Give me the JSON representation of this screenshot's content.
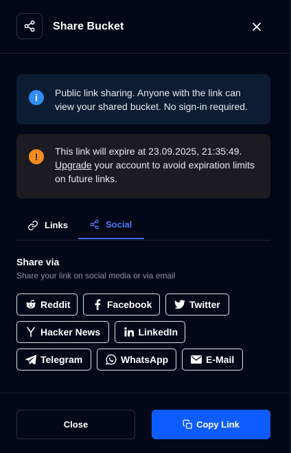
{
  "dialog": {
    "title": "Share Bucket",
    "icon": "share-icon",
    "close_icon": "close-icon"
  },
  "alerts": {
    "info": {
      "icon": "info-icon",
      "text": "Public link sharing. Anyone with the link can view your shared bucket. No sign-in required."
    },
    "warning": {
      "icon": "warning-icon",
      "text_before": "This link will expire at 23.09.2025, 21:35:49.",
      "link": "Upgrade",
      "text_after": " your account to avoid expiration limits on future links."
    }
  },
  "tabs": [
    {
      "label": "Links",
      "icon": "link-icon",
      "active": false
    },
    {
      "label": "Social",
      "icon": "share-icon",
      "active": true
    }
  ],
  "share": {
    "title": "Share via",
    "subtitle": "Share your link on social media or via email",
    "buttons": [
      {
        "label": "Reddit",
        "icon": "reddit-icon"
      },
      {
        "label": "Facebook",
        "icon": "facebook-icon"
      },
      {
        "label": "Twitter",
        "icon": "twitter-icon"
      },
      {
        "label": "Hacker News",
        "icon": "hacker-news-icon"
      },
      {
        "label": "LinkedIn",
        "icon": "linkedin-icon"
      },
      {
        "label": "Telegram",
        "icon": "telegram-icon"
      },
      {
        "label": "WhatsApp",
        "icon": "whatsapp-icon"
      },
      {
        "label": "E-Mail",
        "icon": "email-icon"
      }
    ]
  },
  "footer": {
    "close_label": "Close",
    "copy_label": "Copy Link",
    "copy_icon": "copy-icon"
  },
  "colors": {
    "background": "#020817",
    "accent": "#0d5cff",
    "tab_active": "#4f7bf7",
    "info": "#2f8df5",
    "warning": "#f68b1f"
  }
}
